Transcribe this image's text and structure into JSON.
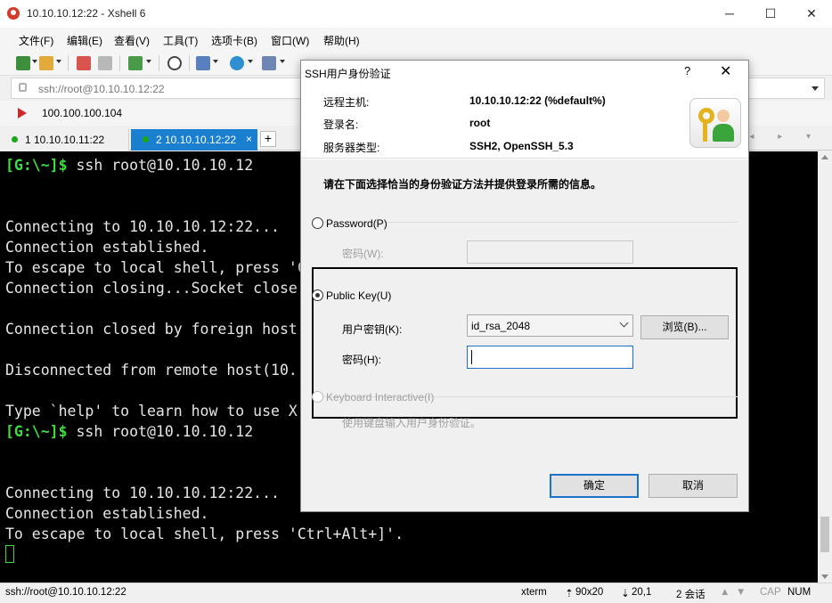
{
  "window": {
    "title": "10.10.10.12:22 - Xshell 6",
    "minimize": "─",
    "maximize": "☐",
    "close": "✕"
  },
  "menu": [
    "文件(F)",
    "编辑(E)",
    "查看(V)",
    "工具(T)",
    "选项卡(B)",
    "窗口(W)",
    "帮助(H)"
  ],
  "address": {
    "value": "ssh://root@10.10.10.12:22"
  },
  "quick_connect": {
    "label": "100.100.100.104"
  },
  "tabs": [
    {
      "label": "1 10.10.10.11:22",
      "active": false
    },
    {
      "label": "2 10.10.10.12:22",
      "active": true,
      "close": "×"
    }
  ],
  "tab_add": "+",
  "tab_nav": "◂ ▸ ▾",
  "terminal": {
    "lines": [
      {
        "prompt": "[G:\\~]$",
        "text": " ssh root@10.10.10.12"
      },
      {
        "text": ""
      },
      {
        "text": ""
      },
      {
        "text": "Connecting to 10.10.10.12:22..."
      },
      {
        "text": "Connection established."
      },
      {
        "text": "To escape to local shell, press 'C"
      },
      {
        "text": "Connection closing...Socket close"
      },
      {
        "text": ""
      },
      {
        "text": "Connection closed by foreign host"
      },
      {
        "text": ""
      },
      {
        "text": "Disconnected from remote host(10."
      },
      {
        "text": ""
      },
      {
        "text": "Type `help' to learn how to use X"
      },
      {
        "prompt": "[G:\\~]$",
        "text": " ssh root@10.10.10.12"
      },
      {
        "text": ""
      },
      {
        "text": ""
      },
      {
        "text": "Connecting to 10.10.10.12:22..."
      },
      {
        "text": "Connection established."
      },
      {
        "text": "To escape to local shell, press 'Ctrl+Alt+]'."
      }
    ]
  },
  "status": {
    "session": "ssh://root@10.10.10.12:22",
    "term": "xterm",
    "size": "90x20",
    "position": "20,1",
    "sessions": "2 会话",
    "cap": "CAP",
    "num": "NUM"
  },
  "dialog": {
    "title": "SSH用户身份验证",
    "help": "?",
    "close": "✕",
    "remote_host_label": "远程主机:",
    "remote_host_value": "10.10.10.12:22 (%default%)",
    "login_label": "登录名:",
    "login_value": "root",
    "server_type_label": "服务器类型:",
    "server_type_value": "SSH2, OpenSSH_5.3",
    "instruction": "请在下面选择恰当的身份验证方法并提供登录所需的信息。",
    "password_option": "Password(P)",
    "password_field_label": "密码(W):",
    "publickey_option": "Public Key(U)",
    "user_key_label": "用户密钥(K):",
    "user_key_value": "id_rsa_2048",
    "browse_button": "浏览(B)...",
    "passphrase_label": "密码(H):",
    "keyboard_option": "Keyboard Interactive(I)",
    "keyboard_desc": "使用键盘输入用户身份验证。",
    "ok_button": "确定",
    "cancel_button": "取消"
  },
  "colors": {
    "accent": "#1a7fcf",
    "prompt_green": "#3ddc3d",
    "terminal_bg": "#000000"
  }
}
